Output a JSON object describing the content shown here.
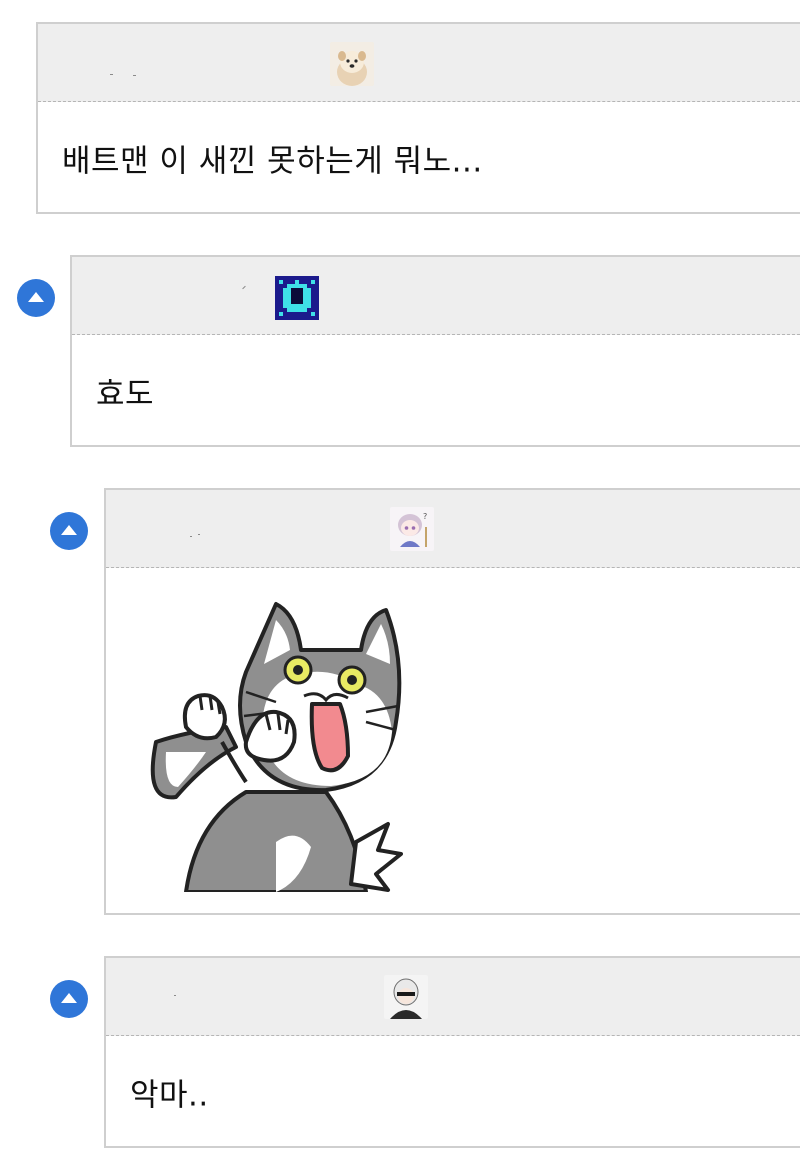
{
  "comments": [
    {
      "text": "배트맨 이 새낀 못하는게 뭐노...",
      "avatar": "puppy-avatar",
      "has_collapse": false
    },
    {
      "text": "효도",
      "avatar": "pixel-ghost-avatar",
      "has_collapse": true
    },
    {
      "text": "",
      "avatar": "anime-girl-avatar",
      "attachment": "surprised-cat-sticker",
      "has_collapse": true
    },
    {
      "text": "악마..",
      "avatar": "android-girl-avatar",
      "has_collapse": true
    }
  ],
  "colors": {
    "header_bg": "#eeeeee",
    "border": "#cfcfcf",
    "collapse_button": "#2f76d8",
    "cat_grey": "#8f8f8f",
    "cat_mouth": "#f28a8f",
    "cat_eye": "#e9ea63"
  },
  "icons": [
    "chevron-up-icon"
  ]
}
